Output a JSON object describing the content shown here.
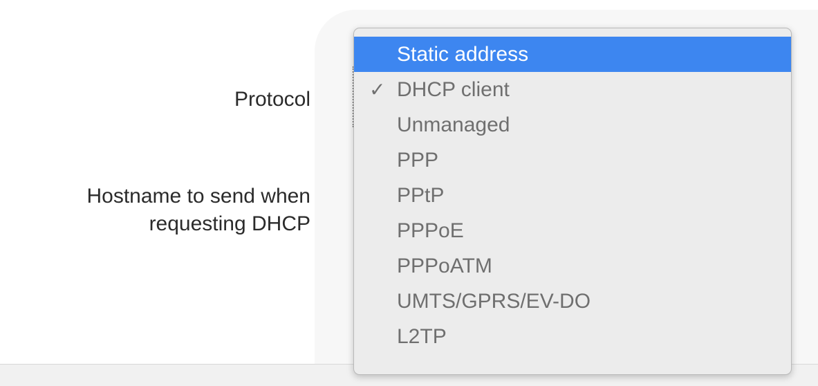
{
  "form": {
    "protocol_label": "Protocol",
    "hostname_label_line1": "Hostname to send when",
    "hostname_label_line2": "requesting DHCP"
  },
  "protocol_menu": {
    "selected": "DHCP client",
    "highlighted": "Static address",
    "checkmark_glyph": "✓",
    "items": [
      {
        "label": "Static address",
        "checked": false,
        "highlighted": true
      },
      {
        "label": "DHCP client",
        "checked": true,
        "highlighted": false
      },
      {
        "label": "Unmanaged",
        "checked": false,
        "highlighted": false
      },
      {
        "label": "PPP",
        "checked": false,
        "highlighted": false
      },
      {
        "label": "PPtP",
        "checked": false,
        "highlighted": false
      },
      {
        "label": "PPPoE",
        "checked": false,
        "highlighted": false
      },
      {
        "label": "PPPoATM",
        "checked": false,
        "highlighted": false
      },
      {
        "label": "UMTS/GPRS/EV-DO",
        "checked": false,
        "highlighted": false
      },
      {
        "label": "L2TP",
        "checked": false,
        "highlighted": false
      }
    ]
  },
  "colors": {
    "highlight": "#3d86f0",
    "menu_background": "#ececec",
    "menu_text": "#6f6f6f",
    "label_text": "#2b2b2b"
  }
}
